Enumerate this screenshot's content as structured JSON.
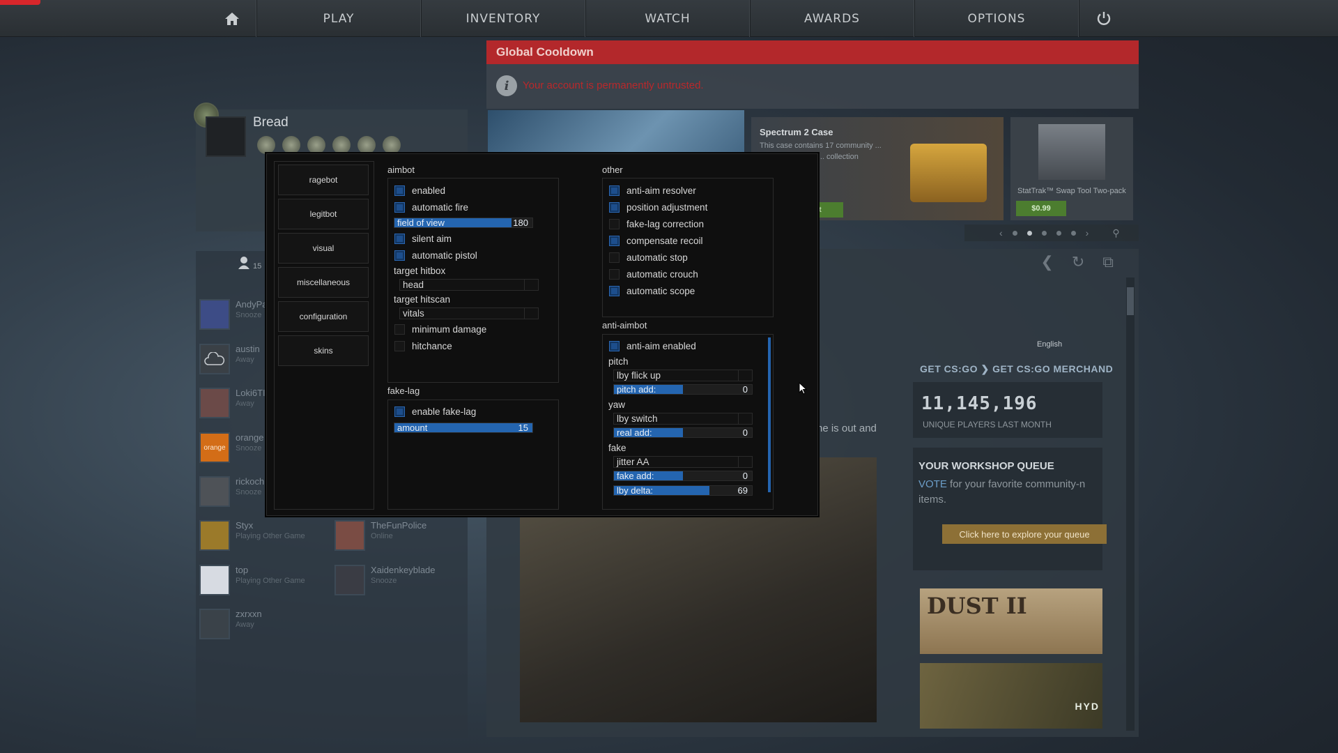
{
  "nav": {
    "items": [
      "PLAY",
      "INVENTORY",
      "WATCH",
      "AWARDS",
      "OPTIONS"
    ]
  },
  "profile": {
    "name": "Bread"
  },
  "friends": {
    "count": "15",
    "list": [
      {
        "name": "AndyPa",
        "status": "Snooze"
      },
      {
        "name": "austin",
        "status": "Away"
      },
      {
        "name": "Loki6TI",
        "status": "Away"
      },
      {
        "name": "orange",
        "status": "Snooze",
        "avatar_text": "orange"
      },
      {
        "name": "rickoch",
        "status": "Snooze"
      },
      {
        "name": "Styx",
        "status": "Playing Other Game"
      },
      {
        "name": "TheFunPolice",
        "status": "Online"
      },
      {
        "name": "top",
        "status": "Playing Other Game"
      },
      {
        "name": "Xaidenkeyblade",
        "status": "Snooze"
      },
      {
        "name": "zxrxxn",
        "status": "Away"
      }
    ]
  },
  "cooldown": {
    "title": "Global Cooldown",
    "message": "Your account is permanently untrusted."
  },
  "store": {
    "spectrum_title": "Spectrum 2 Case",
    "spectrum_desc": "This case contains 17 community ... finishes from the ... collection",
    "spectrum_btn": "ket",
    "swap_title": "StatTrak™ Swap Tool Two-pack",
    "swap_price": "$0.99"
  },
  "right": {
    "language": "English",
    "links": "GET CS:GO ❯   GET CS:GO MERCHAND",
    "players_num": "11,145,196",
    "players_label": "UNIQUE PLAYERS LAST MONTH",
    "wq_title": "YOUR WORKSHOP QUEUE",
    "wq_vote": "VOTE",
    "wq_desc": " for your favorite community-n items.",
    "wq_btn": "Click here to explore your queue",
    "map1": "DUST II",
    "map2": "HYD",
    "news_text": "ne is out and"
  },
  "menu": {
    "tabs": [
      "ragebot",
      "legitbot",
      "visual",
      "miscellaneous",
      "configuration",
      "skins"
    ],
    "aimbot": {
      "title": "aimbot",
      "enabled": "enabled",
      "automatic_fire": "automatic fire",
      "fov_label": "field of view",
      "fov_value": "180",
      "fov_fill": 0.85,
      "silent_aim": "silent aim",
      "automatic_pistol": "automatic pistol",
      "hitbox_label": "target hitbox",
      "hitbox_value": "head",
      "hitscan_label": "target hitscan",
      "hitscan_value": "vitals",
      "minimum_damage": "minimum damage",
      "hitchance": "hitchance"
    },
    "fakelag": {
      "title": "fake-lag",
      "enable": "enable fake-lag",
      "amount_label": "amount",
      "amount_value": "15",
      "amount_fill": 1.0
    },
    "other": {
      "title": "other",
      "items": [
        {
          "label": "anti-aim resolver",
          "checked": true
        },
        {
          "label": "position adjustment",
          "checked": true
        },
        {
          "label": "fake-lag correction",
          "checked": false
        },
        {
          "label": "compensate recoil",
          "checked": true
        },
        {
          "label": "automatic stop",
          "checked": false
        },
        {
          "label": "automatic crouch",
          "checked": false
        },
        {
          "label": "automatic scope",
          "checked": true
        }
      ]
    },
    "antiaim": {
      "title": "anti-aimbot",
      "enabled": "anti-aim enabled",
      "pitch_label": "pitch",
      "pitch_value": "lby flick up",
      "pitch_add_label": "pitch add:",
      "pitch_add_value": "0",
      "pitch_add_fill": 0.5,
      "yaw_label": "yaw",
      "yaw_value": "lby switch",
      "real_add_label": "real add:",
      "real_add_value": "0",
      "real_add_fill": 0.5,
      "fake_label": "fake",
      "fake_value": "jitter AA",
      "fake_add_label": "fake add:",
      "fake_add_value": "0",
      "fake_add_fill": 0.5,
      "lby_delta_label": "lby delta:",
      "lby_delta_value": "69",
      "lby_delta_fill": 0.69
    }
  }
}
